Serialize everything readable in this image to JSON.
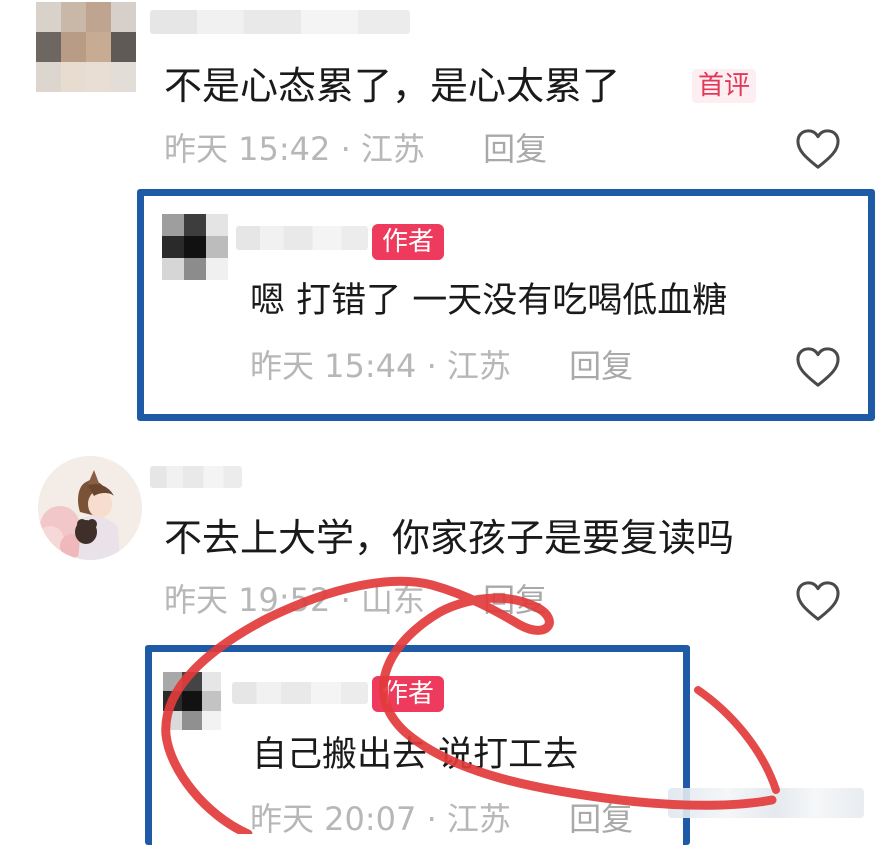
{
  "comments": [
    {
      "text": "不是心态累了，是心太累了",
      "badge": "首评",
      "time": "昨天 15:42",
      "location": "江苏",
      "reply_label": "回复",
      "reply": {
        "badge": "作者",
        "text": "嗯 打错了 一天没有吃喝低血糖",
        "time": "昨天 15:44",
        "location": "江苏",
        "reply_label": "回复"
      }
    },
    {
      "text": "不去上大学，你家孩子是要复读吗",
      "time": "昨天 19:52",
      "location": "山东",
      "reply_label": "回复",
      "reply": {
        "badge": "作者",
        "text": "自己搬出去 说打工去",
        "time": "昨天 20:07",
        "location": "江苏",
        "reply_label": "回复"
      }
    }
  ],
  "colors": {
    "highlight_box": "#1f5aa6",
    "author_badge": "#ee3a5c",
    "first_badge_text": "#e03a5b",
    "annotation_stroke": "#e23b3b"
  },
  "icons": [
    "like-heart-icon"
  ]
}
